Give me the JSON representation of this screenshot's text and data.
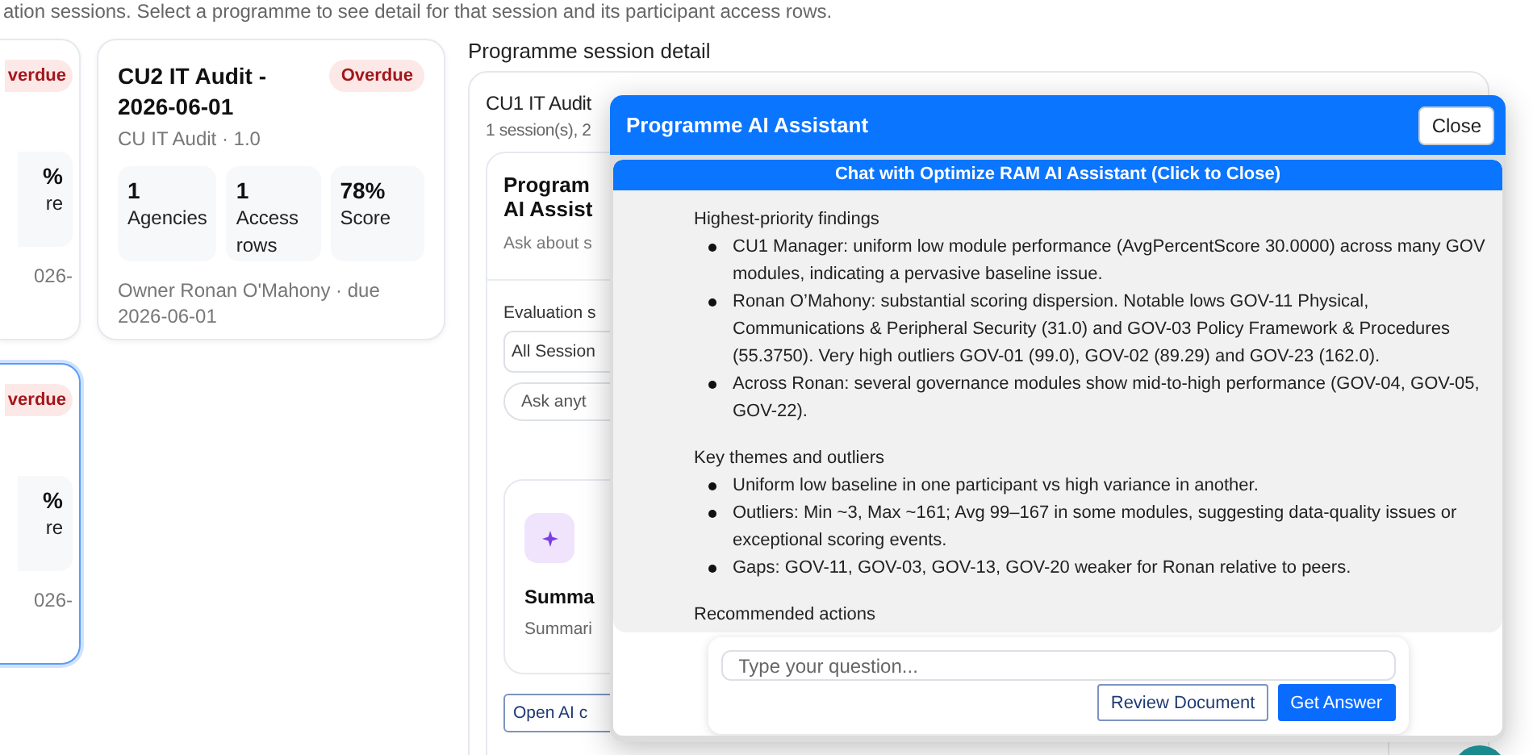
{
  "intro": "ation sessions. Select a programme to see detail for that session and its participant access rows.",
  "programme_cards": [
    {
      "kind": "partial",
      "selected": false,
      "badge": "verdue",
      "stats": [
        {
          "value": "%",
          "label": "re"
        }
      ],
      "footer": "026-"
    },
    {
      "kind": "full",
      "selected": false,
      "title": "CU2 IT Audit - 2026-06-01",
      "badge": "Overdue",
      "subtitle": "CU IT Audit · 1.0",
      "stats": [
        {
          "value": "1",
          "label": "Agencies"
        },
        {
          "value": "1",
          "label": "Access rows"
        },
        {
          "value": "78%",
          "label": "Score"
        }
      ],
      "footer": "Owner Ronan O'Mahony · due 2026-06-01"
    },
    {
      "kind": "partial",
      "selected": true,
      "badge": "verdue",
      "stats": [
        {
          "value": "%",
          "label": "re"
        }
      ],
      "footer": "026-"
    }
  ],
  "detail": {
    "heading": "Programme session detail",
    "title": "CU1 IT Audit",
    "summary": "1 session(s), 2",
    "assistant_card": {
      "title_lines": [
        "Program",
        "AI Assist"
      ],
      "subtitle": "Ask about s",
      "filter_label": "Evaluation s",
      "filter_value": "All Session",
      "prompt_placeholder": "Ask anyt",
      "tile": {
        "title": "Summa",
        "text": "Summari"
      },
      "open_button": "Open AI c"
    }
  },
  "assistant": {
    "title": "Programme AI Assistant",
    "close": "Close",
    "banner": "Chat with Optimize RAM AI Assistant (Click to Close)",
    "sections": [
      {
        "heading": "Highest-priority findings",
        "bullets": [
          "CU1 Manager: uniform low module performance (AvgPercentScore 30.0000) across many GOV modules, indicating a pervasive baseline issue.",
          "Ronan O’Mahony: substantial scoring dispersion. Notable lows GOV-11 Physical, Communications & Peripheral Security (31.0) and GOV-03 Policy Framework & Procedures (55.3750). Very high outliers GOV-01 (99.0), GOV-02 (89.29) and GOV-23 (162.0).",
          "Across Ronan: several governance modules show mid-to-high performance (GOV-04, GOV-05, GOV-22)."
        ]
      },
      {
        "heading": "Key themes and outliers",
        "bullets": [
          "Uniform low baseline in one participant vs high variance in another.",
          "Outliers: Min ~3, Max ~161; Avg 99–167 in some modules, suggesting data-quality issues or exceptional scoring events.",
          "Gaps: GOV-11, GOV-03, GOV-13, GOV-20 weaker for Ronan relative to peers."
        ]
      },
      {
        "heading": "Recommended actions"
      }
    ],
    "input": {
      "placeholder": "Type your question..."
    },
    "buttons": [
      {
        "label": "Review Document",
        "kind": "outline"
      },
      {
        "label": "Get Answer",
        "kind": "primary"
      }
    ]
  }
}
